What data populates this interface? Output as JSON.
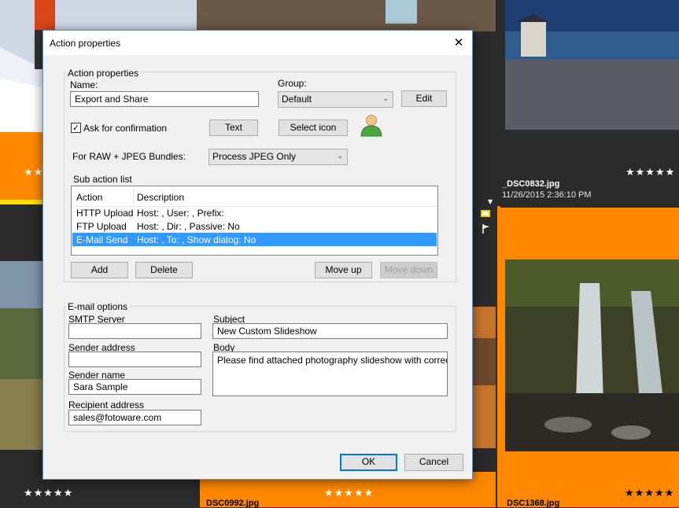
{
  "gallery": {
    "tiles": [
      {
        "stars": "★★",
        "filename": "",
        "date": ""
      },
      {
        "stars": "★★★★★",
        "filename": "_DSC0832.jpg",
        "date": "11/26/2015 2:36:10 PM"
      },
      {
        "stars": "★★★★★",
        "filename": "",
        "date": ""
      },
      {
        "stars": "★★★★★",
        "filename": "DSC0992.jpg",
        "date": ""
      },
      {
        "stars": "★★★★★",
        "filename": "DSC1368.jpg",
        "date": ""
      }
    ],
    "colors": {
      "selected_tile": "#ff8800",
      "tile_bg": "#2b2b2b"
    }
  },
  "dialog": {
    "title": "Action properties",
    "close_glyph": "✕",
    "action_group": {
      "legend": "Action properties",
      "name_label": "Name:",
      "name_value": "Export and Share",
      "group_label": "Group:",
      "group_value": "Default",
      "edit_button": "Edit",
      "confirm_label": "Ask for confirmation",
      "confirm_checked": "✓",
      "text_button": "Text",
      "select_icon_button": "Select icon",
      "icon": "user-icon",
      "raw_label": "For RAW + JPEG Bundles:",
      "raw_value": "Process JPEG Only",
      "sub_action_label": "Sub action list",
      "columns": [
        "Action",
        "Description"
      ],
      "rows": [
        {
          "action": "HTTP Upload",
          "description": "Host: , User: , Prefix:"
        },
        {
          "action": "FTP Upload",
          "description": "Host: , Dir: , Passive: No"
        },
        {
          "action": "E-Mail Send",
          "description": "Host: , To: , Show dialog: No",
          "selected": true
        }
      ],
      "add_button": "Add",
      "delete_button": "Delete",
      "move_up_button": "Move up",
      "move_down_button": "Move down"
    },
    "email_group": {
      "legend": "E-mail options",
      "smtp_label": "SMTP Server",
      "smtp_value": "",
      "sender_address_label": "Sender address",
      "sender_address_value": "",
      "sender_name_label": "Sender name",
      "sender_name_value": "Sara Sample",
      "recipient_label": "Recipient address",
      "recipient_value": "sales@fotoware.com",
      "subject_label": "Subject",
      "subject_value": "New Custom Slideshow",
      "body_label": "Body",
      "body_value": "Please find attached photography slideshow with correct wa"
    },
    "ok_button": "OK",
    "cancel_button": "Cancel"
  }
}
